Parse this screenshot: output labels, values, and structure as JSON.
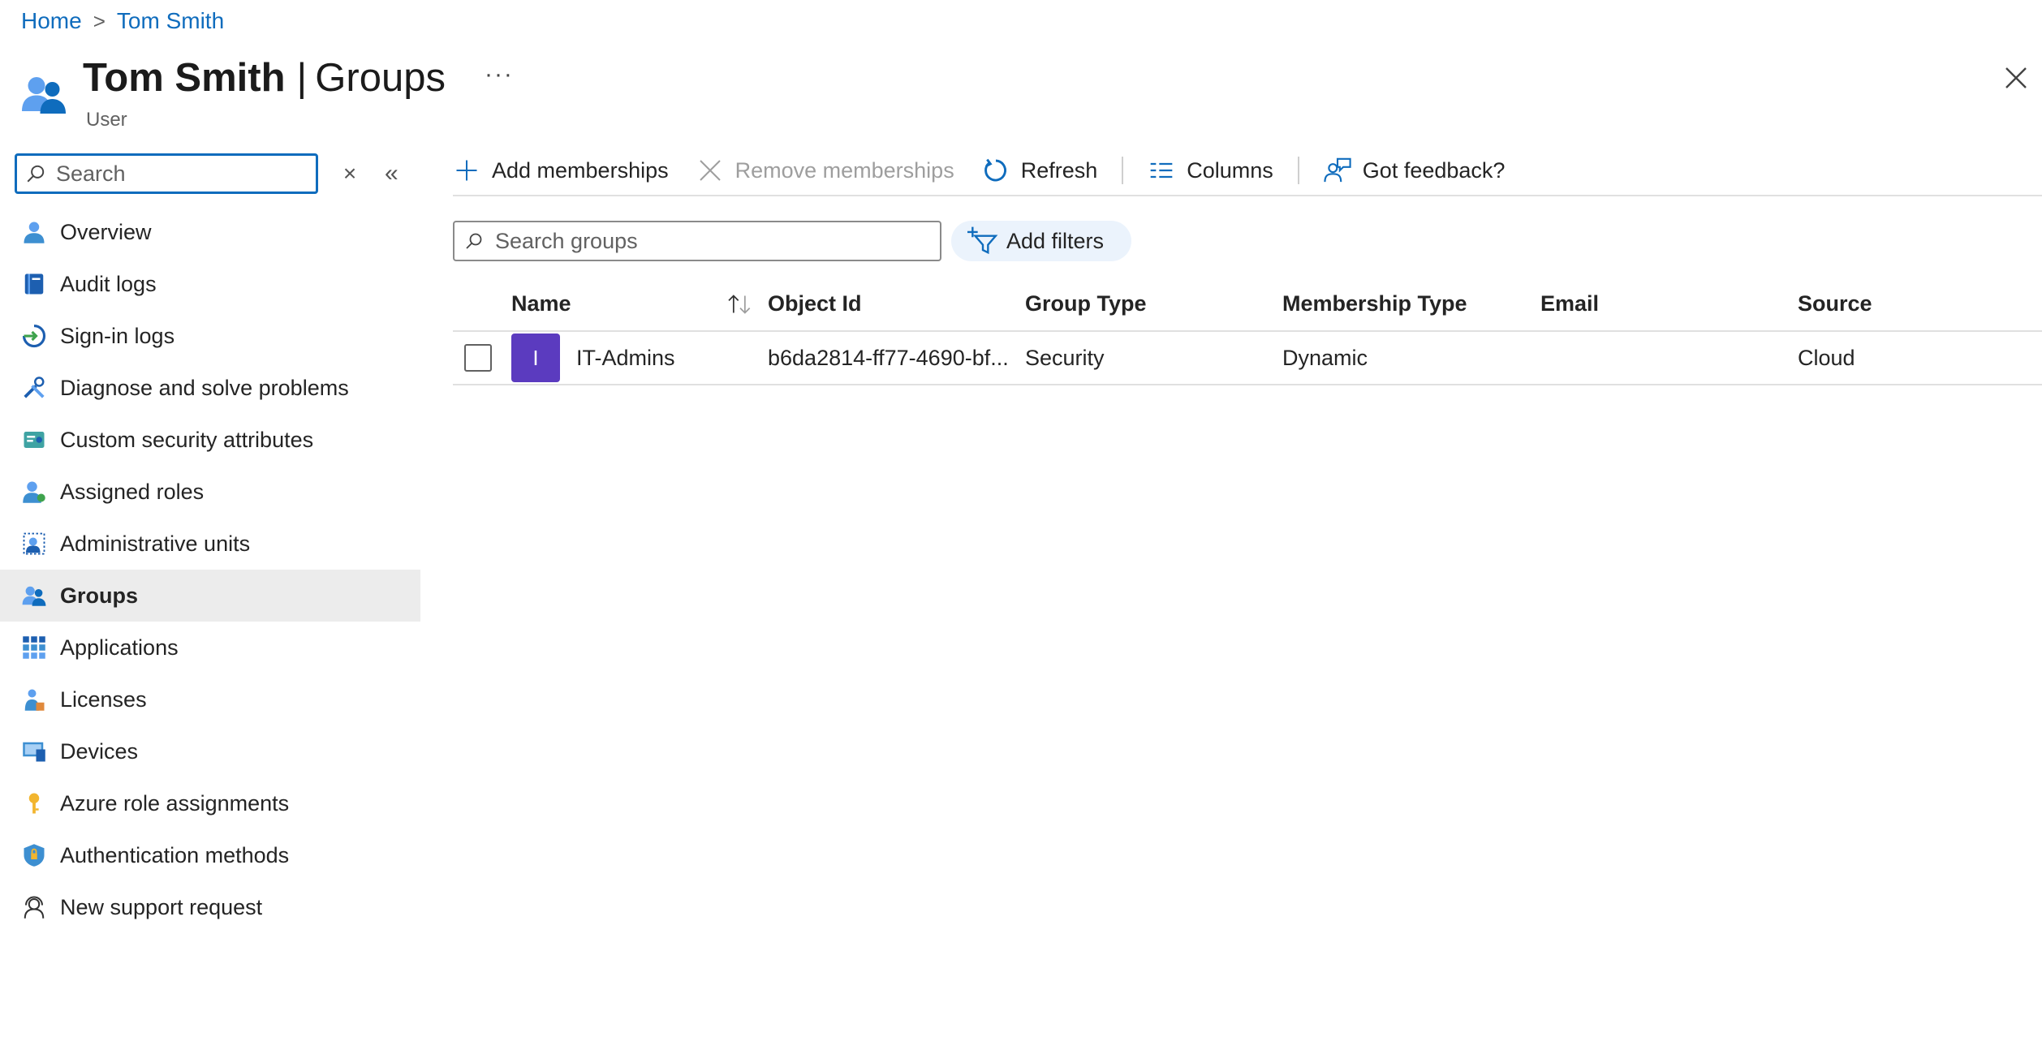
{
  "breadcrumb": {
    "items": [
      "Home",
      "Tom Smith"
    ],
    "separator": ">"
  },
  "header": {
    "title": "Tom Smith",
    "section": "Groups",
    "divider": "|",
    "subtitle": "User",
    "more": "···"
  },
  "sidebar": {
    "search_placeholder": "Search",
    "clear": "×",
    "collapse": "«",
    "items": [
      {
        "label": "Overview",
        "icon": "user-icon"
      },
      {
        "label": "Audit logs",
        "icon": "log-book-icon"
      },
      {
        "label": "Sign-in logs",
        "icon": "sign-in-icon"
      },
      {
        "label": "Diagnose and solve problems",
        "icon": "tools-icon"
      },
      {
        "label": "Custom security attributes",
        "icon": "attributes-icon"
      },
      {
        "label": "Assigned roles",
        "icon": "assigned-roles-icon"
      },
      {
        "label": "Administrative units",
        "icon": "admin-units-icon"
      },
      {
        "label": "Groups",
        "icon": "groups-icon",
        "active": true
      },
      {
        "label": "Applications",
        "icon": "apps-grid-icon"
      },
      {
        "label": "Licenses",
        "icon": "license-icon"
      },
      {
        "label": "Devices",
        "icon": "device-icon"
      },
      {
        "label": "Azure role assignments",
        "icon": "key-icon"
      },
      {
        "label": "Authentication methods",
        "icon": "shield-icon"
      },
      {
        "label": "New support request",
        "icon": "support-icon"
      }
    ]
  },
  "toolbar": {
    "add_memberships": "Add memberships",
    "remove_memberships": "Remove memberships",
    "refresh": "Refresh",
    "columns": "Columns",
    "feedback": "Got feedback?"
  },
  "filters": {
    "search_placeholder": "Search groups",
    "add_filters": "Add filters"
  },
  "table": {
    "columns": [
      "Name",
      "Object Id",
      "Group Type",
      "Membership Type",
      "Email",
      "Source"
    ],
    "rows": [
      {
        "avatar_letter": "I",
        "name": "IT-Admins",
        "object_id": "b6da2814-ff77-4690-bf...",
        "group_type": "Security",
        "membership_type": "Dynamic",
        "email": "",
        "source": "Cloud"
      }
    ]
  },
  "colors": {
    "accent": "#0f6cbd",
    "avatar": "#5b3bbf",
    "active_nav": "#ececec",
    "filter_pill": "#ebf3fc"
  }
}
